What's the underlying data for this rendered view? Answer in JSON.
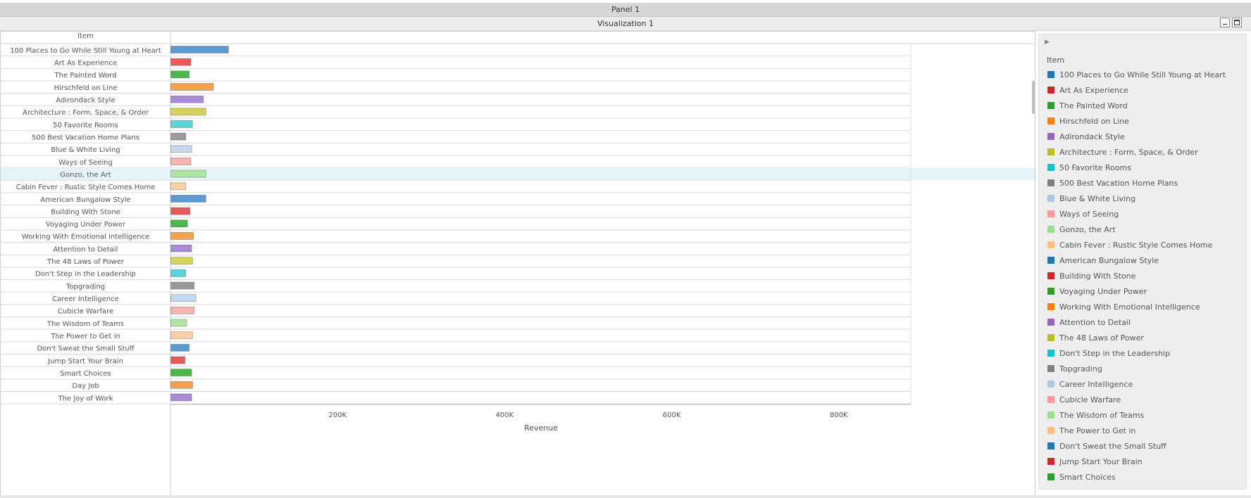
{
  "panel_title": "Panel 1",
  "viz_title": "Visualization 1",
  "chart_data": {
    "type": "bar",
    "orientation": "horizontal",
    "category_header": "Item",
    "xlabel": "Revenue",
    "xlim": [
      0,
      1000000
    ],
    "x_ticks": [
      200000,
      400000,
      600000,
      800000
    ],
    "x_tick_labels": [
      "200K",
      "400K",
      "600K",
      "800K"
    ],
    "highlighted_category": "Gonzo, the Art",
    "categories": [
      "100 Places to Go While Still Young at Heart",
      "Art As Experience",
      "The Painted Word",
      "Hirschfeld on Line",
      "Adirondack Style",
      "Architecture : Form, Space, & Order",
      "50 Favorite Rooms",
      "500 Best Vacation Home Plans",
      "Blue & White Living",
      "Ways of Seeing",
      "Gonzo, the Art",
      "Cabin Fever : Rustic Style Comes Home",
      "American Bungalow Style",
      "Building With Stone",
      "Voyaging Under Power",
      "Working With Emotional Intelligence",
      "Attention to Detail",
      "The 48 Laws of Power",
      "Don't Step in the Leadership",
      "Topgrading",
      "Career Intelligence",
      "Cubicle Warfare",
      "The Wisdom of Teams",
      "The Power to Get in",
      "Don't Sweat the Small Stuff",
      "Jump Start Your Brain",
      "Smart Choices",
      "Day Job",
      "The Joy of Work"
    ],
    "values": [
      69000,
      24000,
      22000,
      51000,
      39000,
      42000,
      26000,
      18000,
      25000,
      24000,
      42000,
      18000,
      42000,
      23000,
      20000,
      27000,
      25000,
      26000,
      18000,
      28000,
      30000,
      28000,
      19000,
      26000,
      22000,
      17000,
      25000,
      26000,
      25000
    ]
  },
  "legend": {
    "title": "Item",
    "items": [
      "100 Places to Go While Still Young at Heart",
      "Art As Experience",
      "The Painted Word",
      "Hirschfeld on Line",
      "Adirondack Style",
      "Architecture : Form, Space, & Order",
      "50 Favorite Rooms",
      "500 Best Vacation Home Plans",
      "Blue & White Living",
      "Ways of Seeing",
      "Gonzo, the Art",
      "Cabin Fever : Rustic Style Comes Home",
      "American Bungalow Style",
      "Building With Stone",
      "Voyaging Under Power",
      "Working With Emotional Intelligence",
      "Attention to Detail",
      "The 48 Laws of Power",
      "Don't Step in the Leadership",
      "Topgrading",
      "Career Intelligence",
      "Cubicle Warfare",
      "The Wisdom of Teams",
      "The Power to Get in",
      "Don't Sweat the Small Stuff",
      "Jump Start Your Brain",
      "Smart Choices"
    ]
  },
  "palette": {
    "bar_colors": [
      "#5b9bd5",
      "#e85a5a",
      "#4cb84c",
      "#f5a04a",
      "#a98bd4",
      "#d6d35a",
      "#5ad3db",
      "#9a9a9a",
      "#c6d8ef",
      "#f8b4b4",
      "#aee6a4",
      "#fcd0a6"
    ],
    "legend_colors": [
      "#1f77b4",
      "#d62728",
      "#2ca02c",
      "#ff7f0e",
      "#9467bd",
      "#bcbd22",
      "#17becf",
      "#7f7f7f",
      "#aec7e8",
      "#ff9896",
      "#98df8a",
      "#ffbb78"
    ],
    "highlight_row": "#e6f4fb"
  }
}
